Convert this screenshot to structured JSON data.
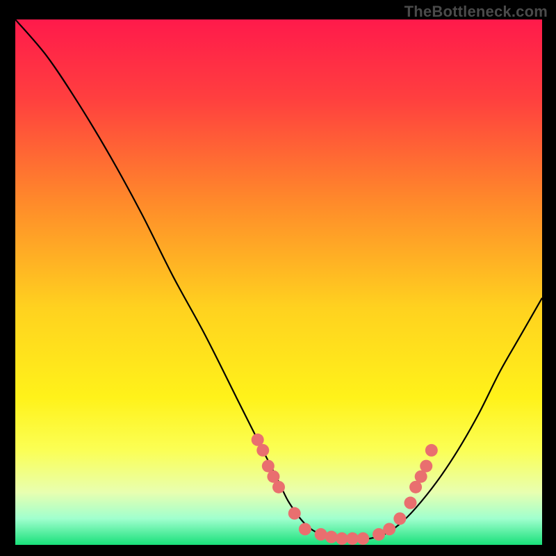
{
  "watermark": "TheBottleneck.com",
  "chart_data": {
    "type": "line",
    "title": "",
    "xlabel": "",
    "ylabel": "",
    "xlim": [
      0,
      100
    ],
    "ylim": [
      0,
      100
    ],
    "background_gradient": {
      "stops": [
        {
          "offset": 0.0,
          "color": "#ff1a4b"
        },
        {
          "offset": 0.15,
          "color": "#ff3f3f"
        },
        {
          "offset": 0.35,
          "color": "#ff8b2a"
        },
        {
          "offset": 0.55,
          "color": "#ffd21f"
        },
        {
          "offset": 0.72,
          "color": "#fff21a"
        },
        {
          "offset": 0.82,
          "color": "#fbff55"
        },
        {
          "offset": 0.9,
          "color": "#e8ffb0"
        },
        {
          "offset": 0.95,
          "color": "#a0ffce"
        },
        {
          "offset": 1.0,
          "color": "#18e07a"
        }
      ]
    },
    "series": [
      {
        "name": "bottleneck-curve",
        "color": "#000000",
        "points": [
          {
            "x": 0,
            "y": 100
          },
          {
            "x": 6,
            "y": 93
          },
          {
            "x": 12,
            "y": 84
          },
          {
            "x": 18,
            "y": 74
          },
          {
            "x": 24,
            "y": 63
          },
          {
            "x": 30,
            "y": 51
          },
          {
            "x": 36,
            "y": 40
          },
          {
            "x": 42,
            "y": 28
          },
          {
            "x": 46,
            "y": 20
          },
          {
            "x": 50,
            "y": 12
          },
          {
            "x": 52,
            "y": 8
          },
          {
            "x": 55,
            "y": 4
          },
          {
            "x": 58,
            "y": 2
          },
          {
            "x": 62,
            "y": 1
          },
          {
            "x": 66,
            "y": 1
          },
          {
            "x": 70,
            "y": 2
          },
          {
            "x": 73,
            "y": 4
          },
          {
            "x": 76,
            "y": 7
          },
          {
            "x": 80,
            "y": 12
          },
          {
            "x": 84,
            "y": 18
          },
          {
            "x": 88,
            "y": 25
          },
          {
            "x": 92,
            "y": 33
          },
          {
            "x": 96,
            "y": 40
          },
          {
            "x": 100,
            "y": 47
          }
        ]
      }
    ],
    "markers": {
      "name": "highlight-dots",
      "color": "#e96f6f",
      "radius": 9,
      "points": [
        {
          "x": 46,
          "y": 20
        },
        {
          "x": 47,
          "y": 18
        },
        {
          "x": 48,
          "y": 15
        },
        {
          "x": 49,
          "y": 13
        },
        {
          "x": 50,
          "y": 11
        },
        {
          "x": 53,
          "y": 6
        },
        {
          "x": 55,
          "y": 3
        },
        {
          "x": 58,
          "y": 2
        },
        {
          "x": 60,
          "y": 1.5
        },
        {
          "x": 62,
          "y": 1.2
        },
        {
          "x": 64,
          "y": 1.2
        },
        {
          "x": 66,
          "y": 1.2
        },
        {
          "x": 69,
          "y": 2
        },
        {
          "x": 71,
          "y": 3
        },
        {
          "x": 73,
          "y": 5
        },
        {
          "x": 75,
          "y": 8
        },
        {
          "x": 76,
          "y": 11
        },
        {
          "x": 77,
          "y": 13
        },
        {
          "x": 78,
          "y": 15
        },
        {
          "x": 79,
          "y": 18
        }
      ]
    }
  }
}
